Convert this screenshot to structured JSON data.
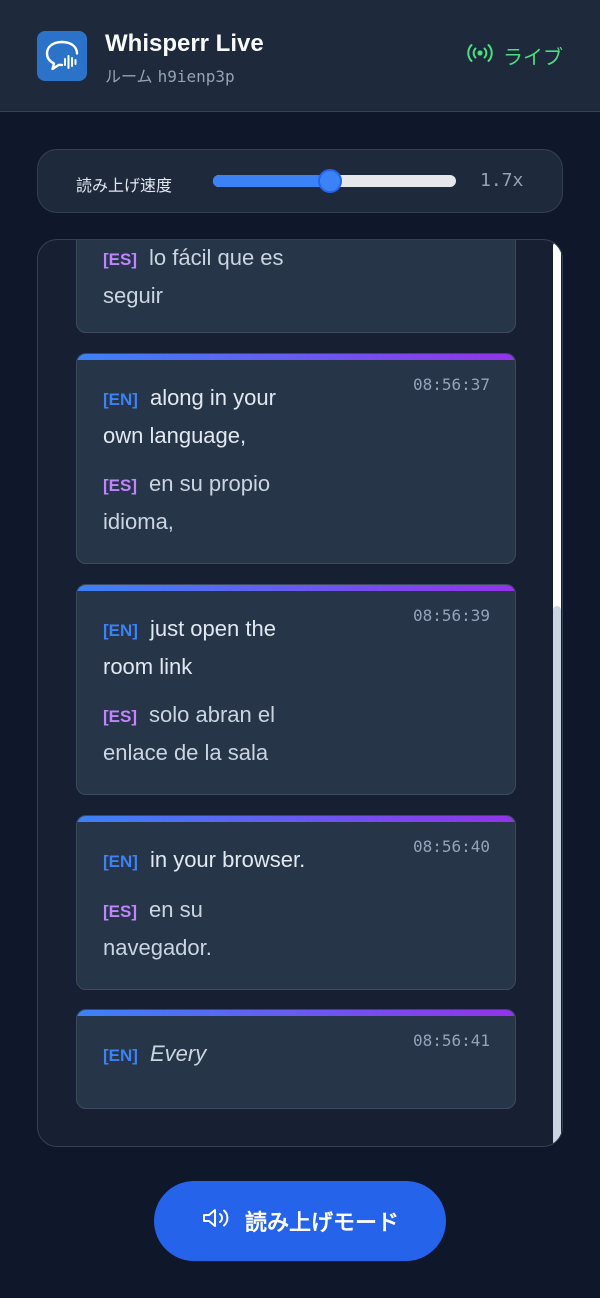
{
  "header": {
    "app_name": "Whisperr Live",
    "room_label": "ルーム",
    "room_code": "h9ienp3p",
    "status_label": "ライブ",
    "logo_icon": "chat-bubble-waveform-icon",
    "status_icon": "broadcast-icon"
  },
  "speed": {
    "label": "読み上げ速度",
    "value_display": "1.7x",
    "fill_fraction": 0.48
  },
  "transcript": {
    "scroll_fraction": 0.6,
    "entries": [
      {
        "timestamp": "",
        "en_tag": "",
        "en": "",
        "es_tag": "[ES]",
        "es_line1": "lo fácil que es",
        "es_line2": "seguir"
      },
      {
        "timestamp": "08:56:37",
        "en_tag": "[EN]",
        "en_line1": "along in your",
        "en_line2": "own language,",
        "es_tag": "[ES]",
        "es_line1": "en su propio",
        "es_line2": "idioma,"
      },
      {
        "timestamp": "08:56:39",
        "en_tag": "[EN]",
        "en_line1": "just open the",
        "en_line2": "room link",
        "es_tag": "[ES]",
        "es_line1": "solo abran el",
        "es_line2": "enlace de la sala"
      },
      {
        "timestamp": "08:56:40",
        "en_tag": "[EN]",
        "en_line1": "in your browser.",
        "es_tag": "[ES]",
        "es_line1": "en su",
        "es_line2": "navegador."
      },
      {
        "timestamp": "08:56:41",
        "en_tag": "[EN]",
        "en_line1": "Every"
      }
    ]
  },
  "read_mode_button": {
    "label": "読み上げモード",
    "icon": "speaker-icon"
  },
  "colors": {
    "accent": "#2563eb",
    "live": "#4ade80",
    "en_tag": "#3b82f6",
    "es_tag": "#c084fc"
  }
}
